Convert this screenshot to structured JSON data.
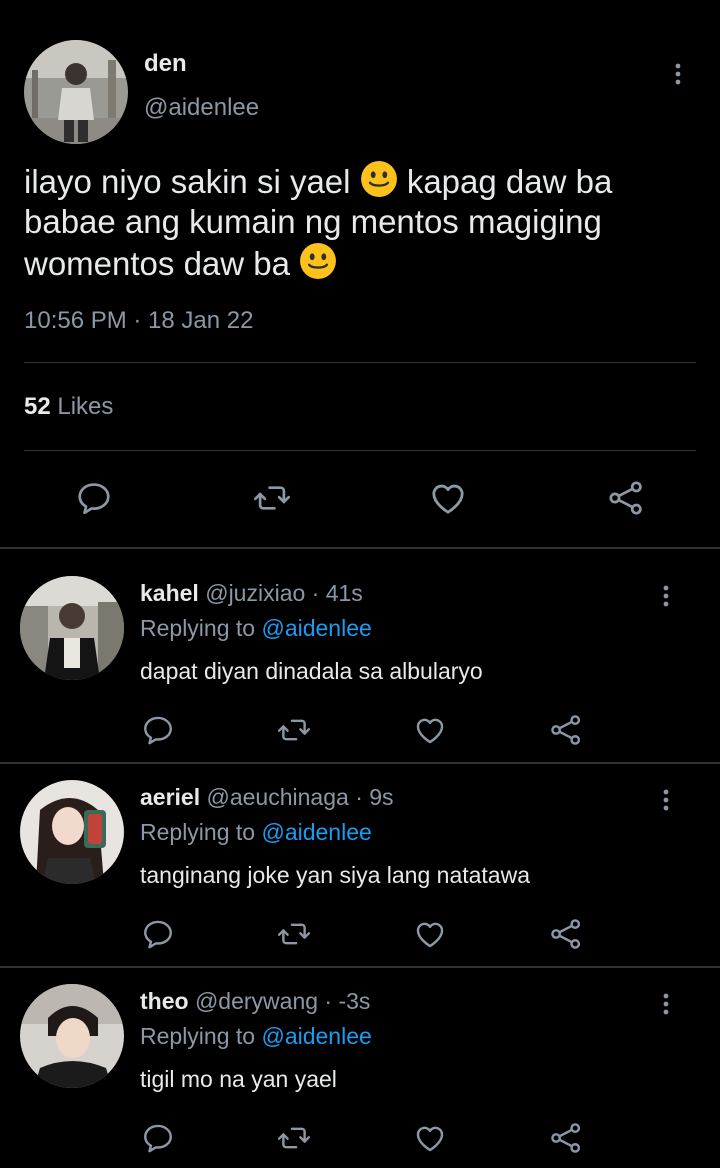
{
  "main_tweet": {
    "display_name": "den",
    "handle": "@aidenlee",
    "text_parts": [
      "ilayo niyo sakin si yael ",
      " kapag daw ba babae ang kumain ng mentos magiging womentos daw ba "
    ],
    "emoji": "slightly-smiling-face",
    "timestamp": "10:56 PM · 18 Jan 22",
    "likes_count": "52",
    "likes_label": "Likes"
  },
  "replies": [
    {
      "display_name": "kahel",
      "handle": "@juzixiao",
      "time": "· 41s",
      "replying_label": "Replying to",
      "mention": "@aidenlee",
      "text": "dapat diyan dinadala sa albularyo"
    },
    {
      "display_name": "aeriel",
      "handle": "@aeuchinaga",
      "time": "· 9s",
      "replying_label": "Replying to",
      "mention": "@aidenlee",
      "text": "tanginang joke yan siya lang natatawa"
    },
    {
      "display_name": "theo",
      "handle": "@derywang",
      "time": "· -3s",
      "replying_label": "Replying to",
      "mention": "@aidenlee",
      "text": "tigil mo na yan yael"
    }
  ],
  "icons": {
    "more": "more-vertical-icon",
    "reply": "reply-icon",
    "retweet": "retweet-icon",
    "like": "heart-icon",
    "share": "share-icon"
  },
  "colors": {
    "background": "#000000",
    "text": "#e7e9ea",
    "muted": "#8b98a5",
    "link": "#1d9bf0",
    "divider": "#2f3336"
  }
}
